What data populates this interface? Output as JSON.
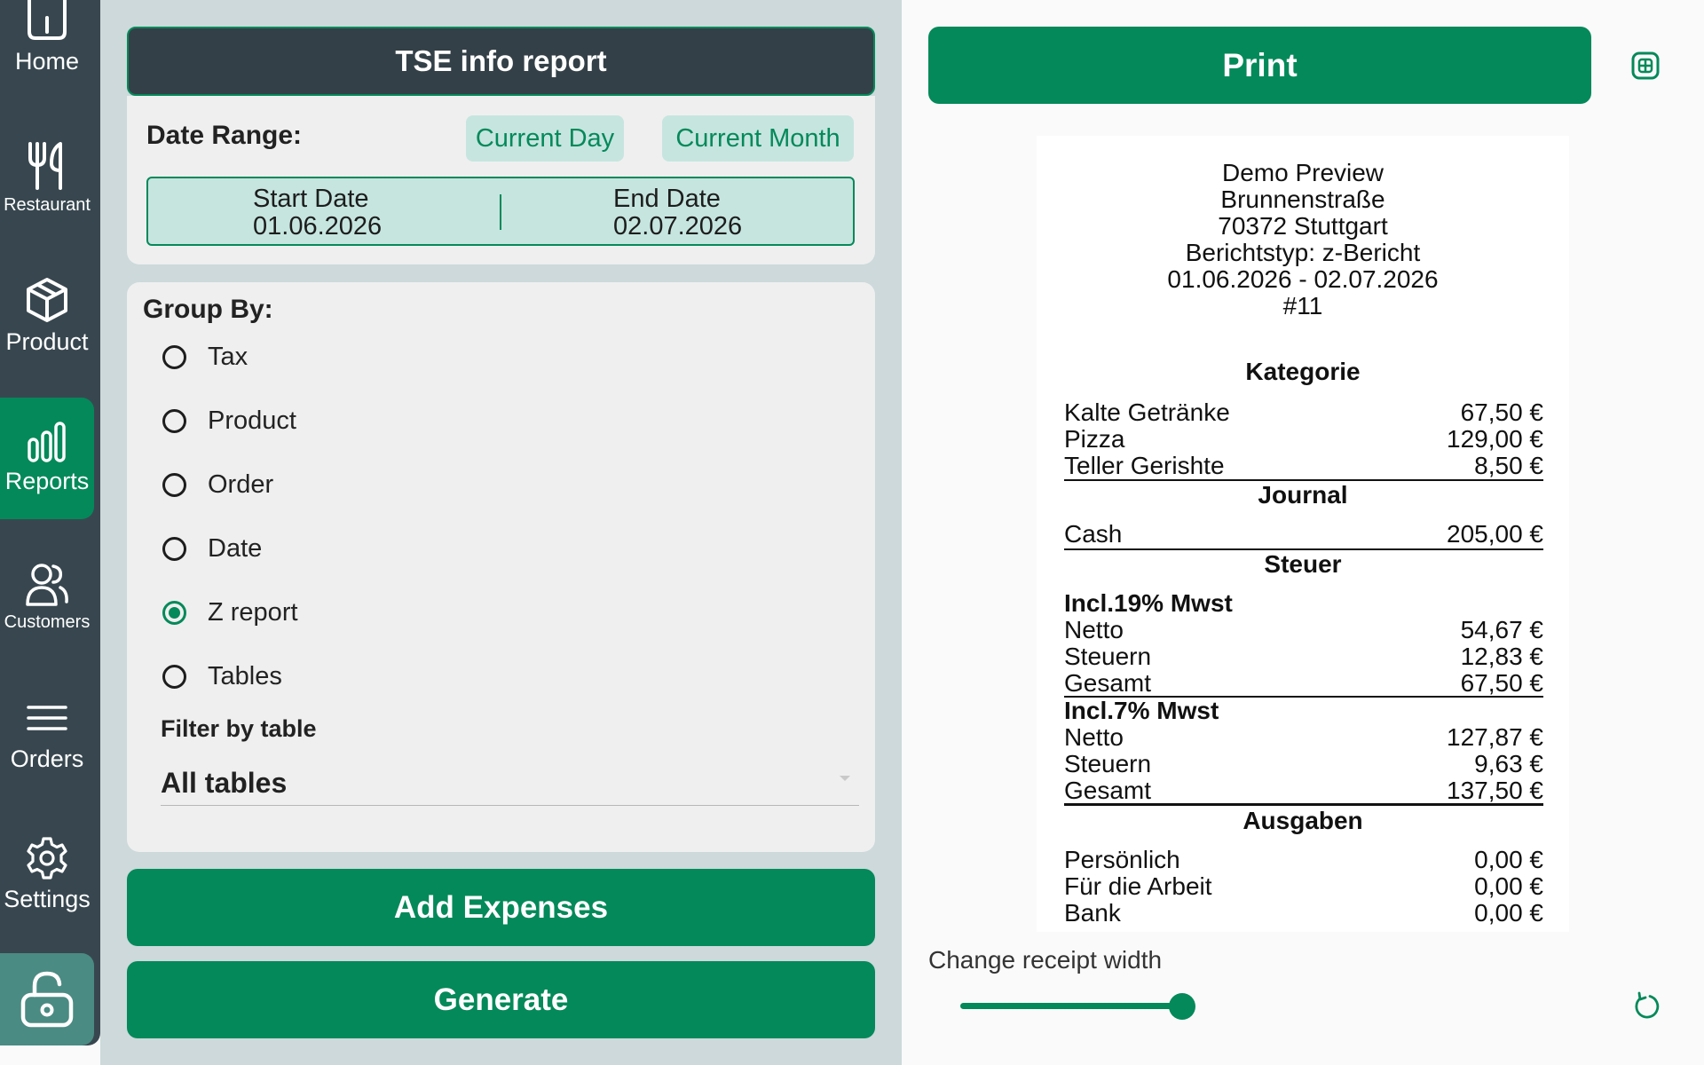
{
  "sidebar": {
    "items": [
      {
        "label": "Home",
        "icon": "home-icon"
      },
      {
        "label": "Restaurant",
        "icon": "fork-knife-icon"
      },
      {
        "label": "Product",
        "icon": "box-icon"
      },
      {
        "label": "Reports",
        "icon": "bar-chart-icon",
        "active": true
      },
      {
        "label": "Customers",
        "icon": "users-icon"
      },
      {
        "label": "Orders",
        "icon": "menu-lines-icon"
      },
      {
        "label": "Settings",
        "icon": "gear-icon"
      }
    ],
    "lock_icon": "lock-icon"
  },
  "report": {
    "title": "TSE info report",
    "date_range_label": "Date Range:",
    "current_day": "Current Day",
    "current_month": "Current Month",
    "start_label": "Start Date",
    "start_value": "01.06.2026",
    "end_label": "End Date",
    "end_value": "02.07.2026",
    "group_by_label": "Group By:",
    "group_options": [
      {
        "label": "Tax",
        "checked": false
      },
      {
        "label": "Product",
        "checked": false
      },
      {
        "label": "Order",
        "checked": false
      },
      {
        "label": "Date",
        "checked": false
      },
      {
        "label": "Z report",
        "checked": true
      },
      {
        "label": "Tables",
        "checked": false
      }
    ],
    "filter_label": "Filter by table",
    "filter_value": "All tables",
    "add_expenses": "Add Expenses",
    "generate": "Generate"
  },
  "preview": {
    "print": "Print",
    "change_width_label": "Change receipt width",
    "width_level": 0.8,
    "receipt": {
      "header_lines": [
        "Demo Preview",
        "Brunnenstraße",
        "70372 Stuttgart",
        "Berichtstyp: z-Bericht",
        "01.06.2026 - 02.07.2026",
        "#11"
      ],
      "kategorie_title": "Kategorie",
      "kategorie_rows": [
        {
          "name": "Kalte Getränke",
          "value": "67,50 €"
        },
        {
          "name": "Pizza",
          "value": "129,00 €"
        },
        {
          "name": "Teller Gerishte",
          "value": "8,50 €"
        }
      ],
      "journal_title": "Journal",
      "journal_rows": [
        {
          "name": "Cash",
          "value": "205,00 €"
        }
      ],
      "steuer_title": "Steuer",
      "tax19_title": "Incl.19% Mwst",
      "tax19_rows": [
        {
          "name": "Netto",
          "value": "54,67 €"
        },
        {
          "name": "Steuern",
          "value": "12,83 €"
        },
        {
          "name": "Gesamt",
          "value": "67,50 €"
        }
      ],
      "tax7_title": "Incl.7% Mwst",
      "tax7_rows": [
        {
          "name": "Netto",
          "value": "127,87 €"
        },
        {
          "name": "Steuern",
          "value": "9,63 €"
        },
        {
          "name": "Gesamt",
          "value": "137,50 €"
        }
      ],
      "ausgaben_title": "Ausgaben",
      "ausgaben_rows": [
        {
          "name": "Persönlich",
          "value": "0,00 €"
        },
        {
          "name": "Für die Arbeit",
          "value": "0,00 €"
        },
        {
          "name": "Bank",
          "value": "0,00 €"
        }
      ]
    }
  },
  "colors": {
    "accent": "#04895a",
    "sidebar": "#38474f",
    "title_bar": "#344047",
    "chip_bg": "#c6e5df",
    "panel_bg": "#cdd9da"
  }
}
